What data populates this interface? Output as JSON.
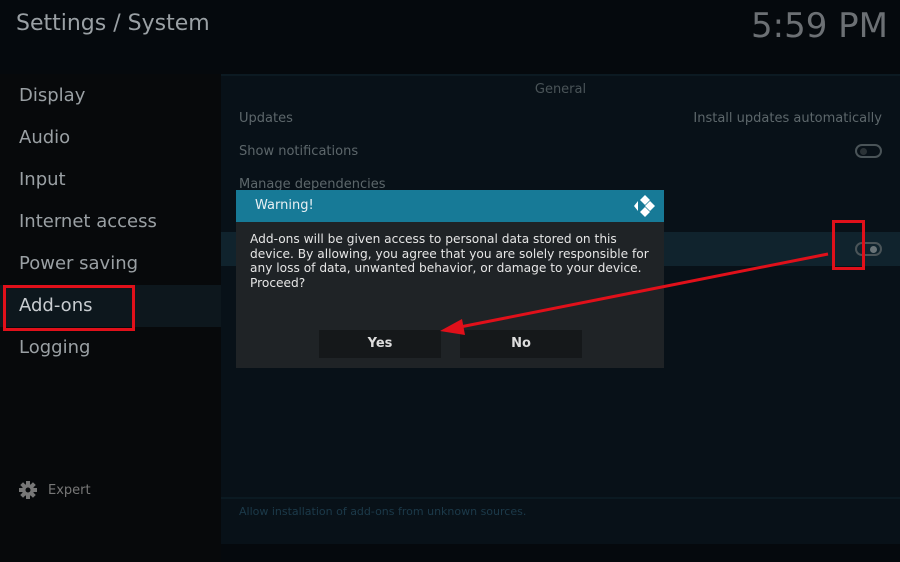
{
  "header": {
    "title": "Settings / System",
    "clock": "5:59 PM"
  },
  "sidebar": {
    "items": [
      {
        "label": "Display"
      },
      {
        "label": "Audio"
      },
      {
        "label": "Input"
      },
      {
        "label": "Internet access"
      },
      {
        "label": "Power saving"
      },
      {
        "label": "Add-ons"
      },
      {
        "label": "Logging"
      }
    ],
    "selected": "Add-ons",
    "expert_label": "Expert"
  },
  "main": {
    "group": "General",
    "rows": [
      {
        "label": "Updates",
        "value": "Install updates automatically"
      },
      {
        "label": "Show notifications",
        "toggle": false
      },
      {
        "label": "Manage dependencies"
      },
      {
        "label": "",
        "toggle": true
      }
    ],
    "description": "Allow installation of add-ons from unknown sources."
  },
  "dialog": {
    "title": "Warning!",
    "message": "Add-ons will be given access to personal data stored on this device. By allowing, you agree that you are solely responsible for any loss of data, unwanted behavior, or damage to your device. Proceed?",
    "yes": "Yes",
    "no": "No"
  },
  "colors": {
    "accent": "#177a97",
    "annotation": "#e0101a"
  }
}
